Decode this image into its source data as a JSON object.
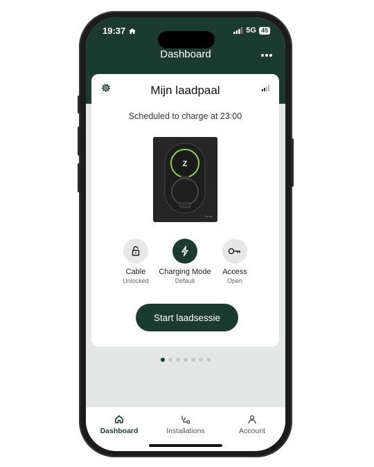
{
  "status_bar": {
    "time": "19:37",
    "network": "5G",
    "battery": "45"
  },
  "header": {
    "title": "Dashboard",
    "more_icon": "more-horizontal-icon"
  },
  "card": {
    "title": "Mijn laadpaal",
    "schedule_text": "Scheduled to charge at 23:00",
    "actions": [
      {
        "label": "Cable",
        "sub": "Unlocked",
        "icon": "lock-open-icon"
      },
      {
        "label": "Charging Mode",
        "sub": "Default",
        "icon": "lightning-icon"
      },
      {
        "label": "Access",
        "sub": "Open",
        "icon": "key-icon"
      }
    ],
    "start_button": "Start laadsessie"
  },
  "pagination": {
    "count": 7,
    "active": 0
  },
  "tabs": [
    {
      "label": "Dashboard",
      "icon": "home-icon",
      "active": true
    },
    {
      "label": "Installations",
      "icon": "plug-icon",
      "active": false
    },
    {
      "label": "Account",
      "icon": "user-icon",
      "active": false
    }
  ],
  "colors": {
    "brand": "#1b3b31",
    "background": "#e5e7e6",
    "accent_ring": "#8fd14f"
  }
}
